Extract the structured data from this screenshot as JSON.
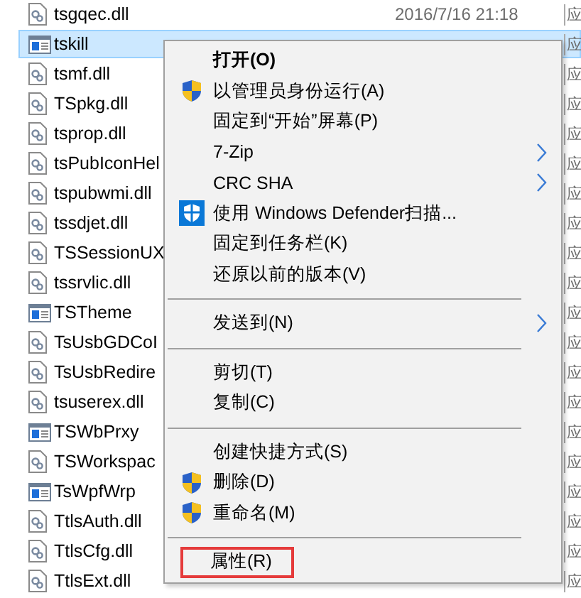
{
  "files": [
    {
      "name": "tsgqec.dll",
      "kind": "dll",
      "selected": false,
      "date": "2016/7/16 21:18",
      "type": "应"
    },
    {
      "name": "tskill",
      "kind": "app",
      "selected": true,
      "type": "应"
    },
    {
      "name": "tsmf.dll",
      "kind": "dll",
      "selected": false,
      "type": "应"
    },
    {
      "name": "TSpkg.dll",
      "kind": "dll",
      "selected": false,
      "type": "应"
    },
    {
      "name": "tsprop.dll",
      "kind": "dll",
      "selected": false,
      "type": "应"
    },
    {
      "name": "tsPubIconHel",
      "kind": "dll",
      "selected": false,
      "type": "应"
    },
    {
      "name": "tspubwmi.dll",
      "kind": "dll",
      "selected": false,
      "type": "应"
    },
    {
      "name": "tssdjet.dll",
      "kind": "dll",
      "selected": false,
      "type": "应"
    },
    {
      "name": "TSSessionUX",
      "kind": "dll",
      "selected": false,
      "type": "应"
    },
    {
      "name": "tssrvlic.dll",
      "kind": "dll",
      "selected": false,
      "type": "应"
    },
    {
      "name": "TSTheme",
      "kind": "app",
      "selected": false,
      "type": "应"
    },
    {
      "name": "TsUsbGDCoI",
      "kind": "dll",
      "selected": false,
      "type": "应"
    },
    {
      "name": "TsUsbRedire",
      "kind": "dll",
      "selected": false,
      "type": "应"
    },
    {
      "name": "tsuserex.dll",
      "kind": "dll",
      "selected": false,
      "type": "应"
    },
    {
      "name": "TSWbPrxy",
      "kind": "app",
      "selected": false,
      "type": "应"
    },
    {
      "name": "TSWorkspac",
      "kind": "dll",
      "selected": false,
      "type": "应"
    },
    {
      "name": "TsWpfWrp",
      "kind": "app",
      "selected": false,
      "type": "应"
    },
    {
      "name": "TtlsAuth.dll",
      "kind": "dll",
      "selected": false,
      "type": "应"
    },
    {
      "name": "TtlsCfg.dll",
      "kind": "dll",
      "selected": false,
      "type": "应"
    },
    {
      "name": "TtlsExt.dll",
      "kind": "dll",
      "selected": false,
      "type": "应"
    }
  ],
  "context_menu": [
    {
      "kind": "item",
      "label": "打开(O)",
      "bold": true
    },
    {
      "kind": "admin-item",
      "label": "以管理员身份运行(A)"
    },
    {
      "kind": "item",
      "label": "固定到“开始”屏幕(P)"
    },
    {
      "kind": "item",
      "label": "7-Zip",
      "submenu": true
    },
    {
      "kind": "item",
      "label": "CRC SHA",
      "submenu": true
    },
    {
      "kind": "defender-item",
      "label": "使用 Windows Defender扫描..."
    },
    {
      "kind": "item",
      "label": "固定到任务栏(K)"
    },
    {
      "kind": "item",
      "label": "还原以前的版本(V)"
    },
    {
      "kind": "separator"
    },
    {
      "kind": "item",
      "label": "发送到(N)",
      "submenu": true
    },
    {
      "kind": "separator"
    },
    {
      "kind": "item",
      "label": "剪切(T)"
    },
    {
      "kind": "item",
      "label": "复制(C)"
    },
    {
      "kind": "separator"
    },
    {
      "kind": "item",
      "label": "创建快捷方式(S)"
    },
    {
      "kind": "admin-item",
      "label": "删除(D)"
    },
    {
      "kind": "admin-item",
      "label": "重命名(M)"
    },
    {
      "kind": "separator"
    },
    {
      "kind": "item",
      "label": "属性(R)",
      "highlighted": true
    }
  ]
}
